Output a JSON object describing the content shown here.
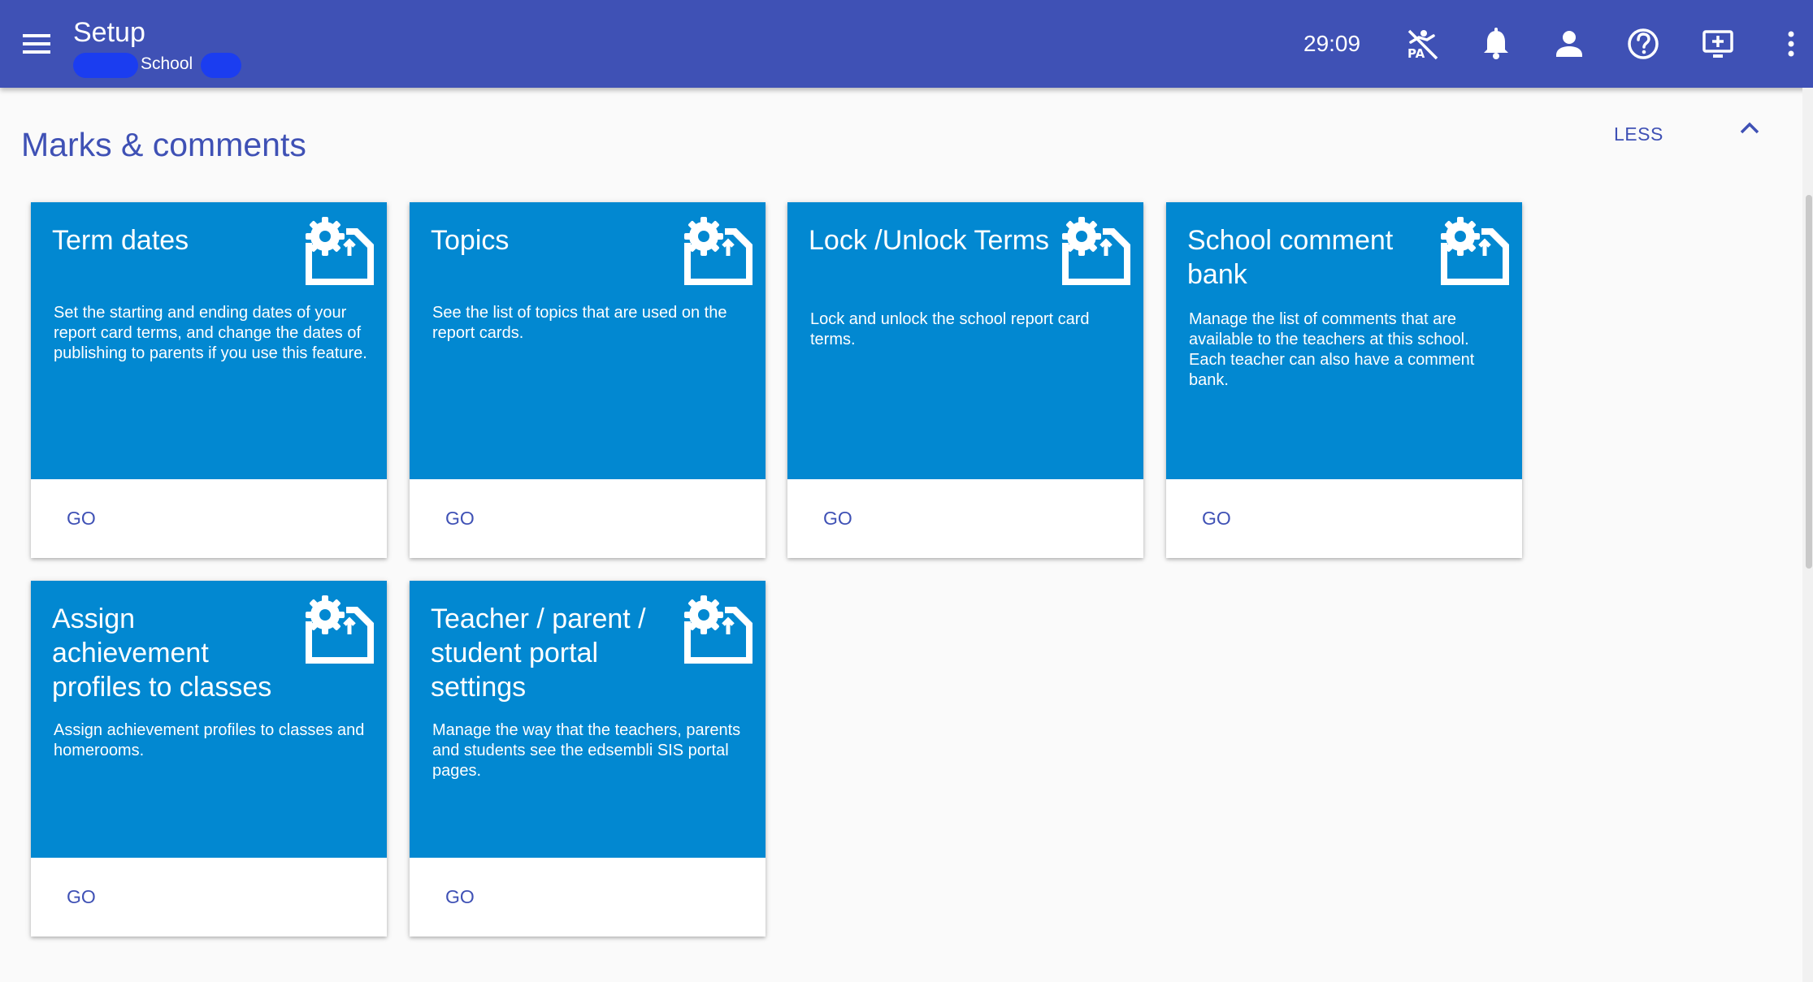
{
  "header": {
    "title": "Setup",
    "subtitle": "School",
    "timer": "29:09",
    "icons": [
      "menu-icon",
      "pa-off-icon",
      "bell-icon",
      "person-icon",
      "help-icon",
      "screen-share-icon",
      "more-vert-icon"
    ]
  },
  "section": {
    "title": "Marks & comments",
    "toggle_label": "LESS"
  },
  "cards": [
    {
      "title": "Term dates",
      "description": "Set the starting and ending dates of your report card terms, and change the dates of publishing to parents if you use this feature.",
      "action": "GO",
      "icon": "settings-folder-icon"
    },
    {
      "title": "Topics",
      "description": "See the list of topics that are used on the report cards.",
      "action": "GO",
      "icon": "settings-folder-icon"
    },
    {
      "title": "Lock /Unlock Terms",
      "description": "Lock and unlock the school report card terms.",
      "action": "GO",
      "icon": "settings-folder-icon"
    },
    {
      "title": "School comment bank",
      "description": "Manage the list of comments that are available to the teachers at this school. Each teacher can also have a comment bank.",
      "action": "GO",
      "icon": "settings-folder-icon"
    },
    {
      "title": "Assign achievement profiles to classes",
      "description": "Assign achievement profiles to classes and homerooms.",
      "action": "GO",
      "icon": "settings-folder-icon"
    },
    {
      "title": "Teacher / parent / student portal settings",
      "description": "Manage the way that the teachers, parents and students see the edsembli SIS portal pages.",
      "action": "GO",
      "icon": "settings-folder-icon"
    }
  ],
  "colors": {
    "appbar": "#3f51b5",
    "card": "#0288d1",
    "accent_text": "#3f51b5",
    "background": "#fafafa"
  }
}
